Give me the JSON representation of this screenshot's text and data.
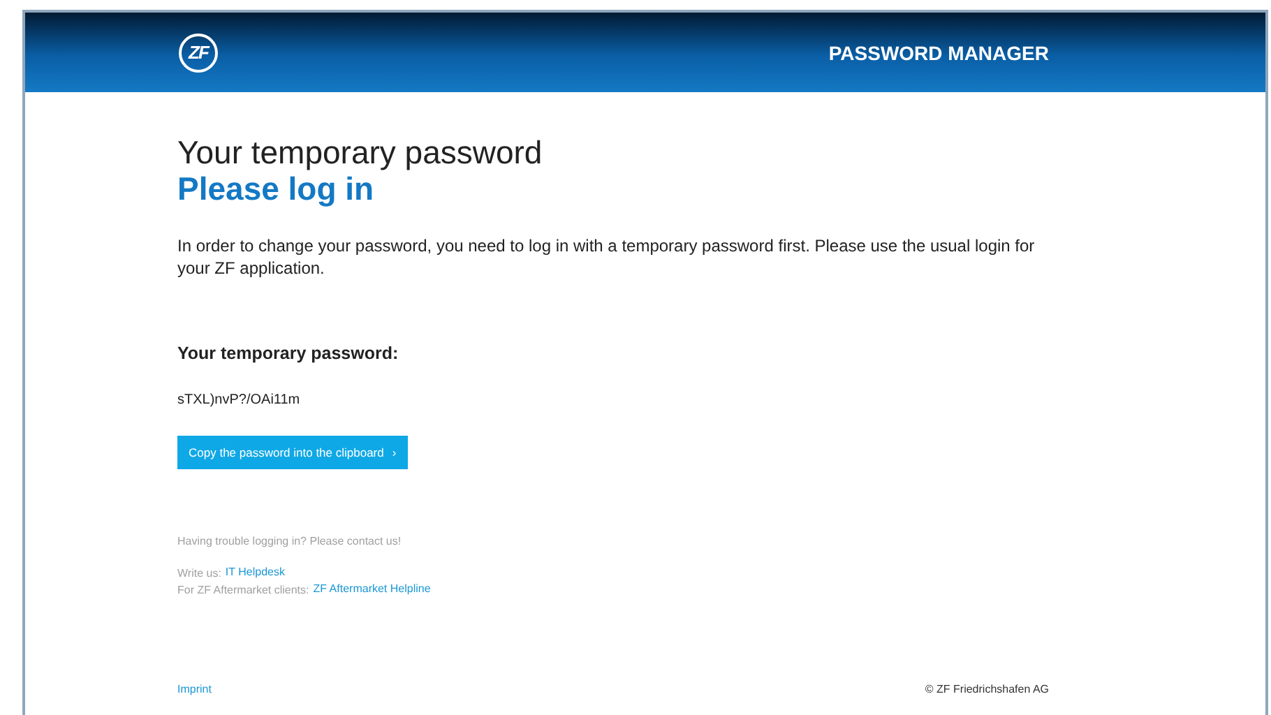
{
  "header": {
    "logo": "ZF",
    "title": "PASSWORD MANAGER"
  },
  "heading": "Your temporary password",
  "subheading": "Please log in",
  "intro": "In order to change your password, you need to log in with a temporary password first. Please use the usual login for your ZF application.",
  "password_label": "Your temporary password:",
  "password": "sTXL)nvP?/OAi11m",
  "copy_button": {
    "label": "Copy the password into the clipboard",
    "caret": "›"
  },
  "help": {
    "trouble": "Having trouble logging in? Please contact us!",
    "lines": [
      {
        "prefix": "Write us:",
        "link": "IT Helpdesk"
      },
      {
        "prefix": "For ZF Aftermarket clients:",
        "link": "ZF Aftermarket Helpline"
      }
    ]
  },
  "footer": {
    "imprint": "Imprint",
    "copyright": "© ZF Friedrichshafen AG"
  }
}
